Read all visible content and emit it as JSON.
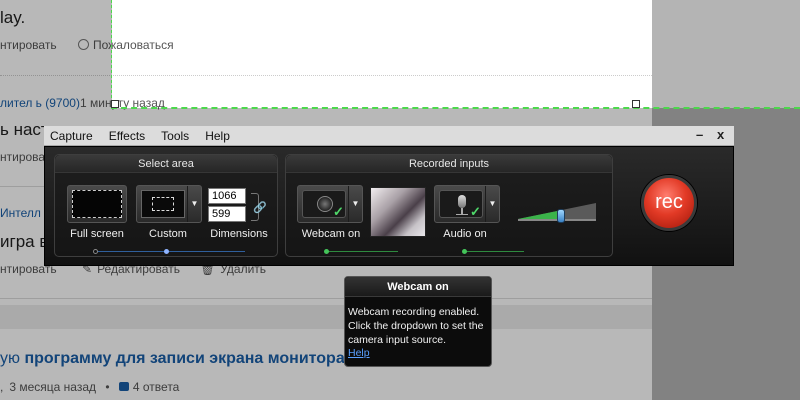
{
  "background_page": {
    "line1": "lay.",
    "action_edit_1": "нтировать",
    "action_complain": "Пожаловаться",
    "author_line": "лител ь (9700)",
    "time_ago": "1 минуту назад",
    "question_fragment": "ь настр",
    "action_edit_2": "нтировать",
    "author_2": "Интелл",
    "question_2": "игра в",
    "action_edit_3": "нтировать",
    "action_edit_post": "Редактировать",
    "action_delete": "Удалить",
    "link_title_prefix": "ую ",
    "link_title_bold": "программу для записи экрана монитора",
    "meta_time": "3 месяца назад",
    "meta_answers": "4 ответа"
  },
  "menu": {
    "items": [
      "Capture",
      "Effects",
      "Tools",
      "Help"
    ],
    "minimize": "–",
    "close": "x"
  },
  "select_area": {
    "title": "Select area",
    "full_screen_label": "Full screen",
    "custom_label": "Custom",
    "dimensions_label": "Dimensions",
    "width": "1066",
    "height": "599"
  },
  "recorded_inputs": {
    "title": "Recorded inputs",
    "webcam_label": "Webcam on",
    "audio_label": "Audio on",
    "audio_level": 0.55
  },
  "record_button": "rec",
  "tooltip": {
    "title": "Webcam on",
    "line1": "Webcam recording enabled.",
    "line2": "Click the dropdown to set the",
    "line3": "camera input source.",
    "link": "Help"
  },
  "colors": {
    "selection_dash": "#4cd84c",
    "rec_red": "#e23a26",
    "link_blue": "#1a5fa8",
    "check_green": "#4fd86a"
  }
}
